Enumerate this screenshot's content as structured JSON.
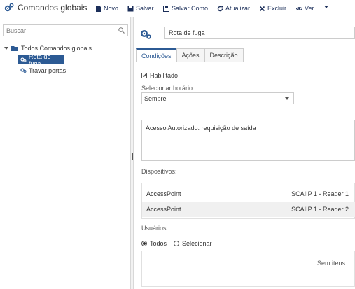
{
  "toolbar": {
    "title": "Comandos globais",
    "buttons": {
      "new": "Novo",
      "save": "Salvar",
      "save_as": "Salvar Como",
      "refresh": "Atualizar",
      "delete": "Excluir",
      "view": "Ver"
    }
  },
  "sidebar": {
    "search_placeholder": "Buscar",
    "tree": {
      "root": "Todos Comandos globais",
      "items": [
        {
          "label": "Rota de fuga",
          "selected": true
        },
        {
          "label": "Travar portas",
          "selected": false
        }
      ]
    }
  },
  "detail": {
    "name": "Rota de fuga",
    "tabs": [
      "Condições",
      "Ações",
      "Descrição"
    ],
    "active_tab": "Condições",
    "enabled_label": "Habilitado",
    "enabled": true,
    "schedule_label": "Selecionar horário",
    "schedule_value": "Sempre",
    "description": "Acesso Autorizado: requisição de saída",
    "devices_label": "Dispositivos:",
    "devices": [
      {
        "name": "AccessPoint",
        "reader": "SCAIIP 1 - Reader 1"
      },
      {
        "name": "AccessPoint",
        "reader": "SCAIIP 1 - Reader 2"
      }
    ],
    "users_label": "Usuários:",
    "users_options": [
      "Todos",
      "Selecionar"
    ],
    "users_selected": "Todos",
    "users_empty": "Sem itens"
  },
  "colors": {
    "accent": "#2c5a94",
    "toolbar_text": "#1c2f5a"
  }
}
